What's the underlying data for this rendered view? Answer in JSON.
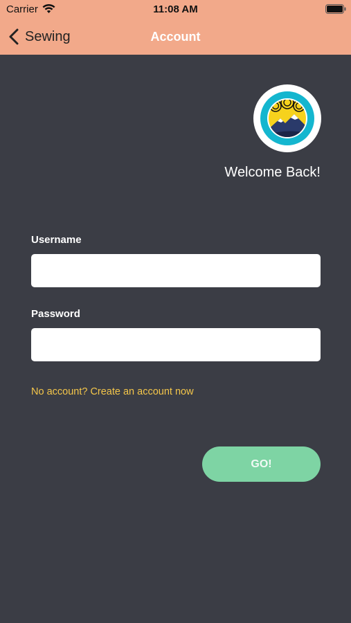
{
  "status_bar": {
    "carrier": "Carrier",
    "time": "11:08 AM",
    "wifi_icon": "wifi-icon",
    "battery_icon": "battery-icon"
  },
  "nav": {
    "back_label": "Sewing",
    "back_icon": "chevron-left-icon",
    "title": "Account"
  },
  "logo": {
    "icon": "mountain-sun-logo"
  },
  "welcome_text": "Welcome Back!",
  "form": {
    "username_label": "Username",
    "username_value": "",
    "password_label": "Password",
    "password_value": "",
    "create_account_link": "No account? Create an account now",
    "submit_label": "GO!"
  },
  "colors": {
    "header_bg": "#f2a98a",
    "page_bg": "#3b3d45",
    "link": "#f4c64a",
    "button": "#7ed4a4"
  }
}
